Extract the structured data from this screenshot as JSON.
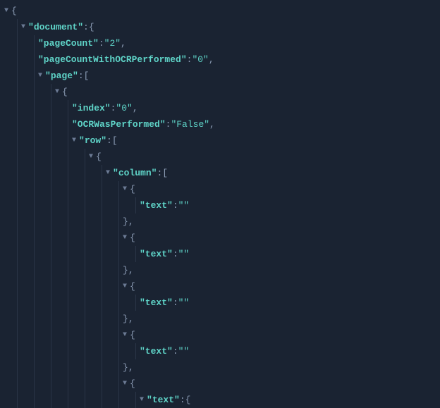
{
  "tree": {
    "rows": [
      {
        "indent": 0,
        "twisty": true,
        "parts": [
          {
            "t": "brace",
            "v": "{"
          }
        ]
      },
      {
        "indent": 1,
        "twisty": true,
        "parts": [
          {
            "t": "key",
            "v": "\"document\""
          },
          {
            "t": "punct",
            "v": ": "
          },
          {
            "t": "brace",
            "v": "{"
          }
        ]
      },
      {
        "indent": 2,
        "twisty": false,
        "parts": [
          {
            "t": "key",
            "v": "\"pageCount\""
          },
          {
            "t": "punct",
            "v": ": "
          },
          {
            "t": "value",
            "v": "\"2\""
          },
          {
            "t": "punct",
            "v": ","
          }
        ]
      },
      {
        "indent": 2,
        "twisty": false,
        "parts": [
          {
            "t": "key",
            "v": "\"pageCountWithOCRPerformed\""
          },
          {
            "t": "punct",
            "v": ": "
          },
          {
            "t": "value",
            "v": "\"0\""
          },
          {
            "t": "punct",
            "v": ","
          }
        ]
      },
      {
        "indent": 2,
        "twisty": true,
        "parts": [
          {
            "t": "key",
            "v": "\"page\""
          },
          {
            "t": "punct",
            "v": ": "
          },
          {
            "t": "brace",
            "v": "["
          }
        ]
      },
      {
        "indent": 3,
        "twisty": true,
        "parts": [
          {
            "t": "brace",
            "v": "{"
          }
        ]
      },
      {
        "indent": 4,
        "twisty": false,
        "parts": [
          {
            "t": "key",
            "v": "\"index\""
          },
          {
            "t": "punct",
            "v": ": "
          },
          {
            "t": "value",
            "v": "\"0\""
          },
          {
            "t": "punct",
            "v": ","
          }
        ]
      },
      {
        "indent": 4,
        "twisty": false,
        "parts": [
          {
            "t": "key",
            "v": "\"OCRWasPerformed\""
          },
          {
            "t": "punct",
            "v": ": "
          },
          {
            "t": "value",
            "v": "\"False\""
          },
          {
            "t": "punct",
            "v": ","
          }
        ]
      },
      {
        "indent": 4,
        "twisty": true,
        "parts": [
          {
            "t": "key",
            "v": "\"row\""
          },
          {
            "t": "punct",
            "v": ": "
          },
          {
            "t": "brace",
            "v": "["
          }
        ]
      },
      {
        "indent": 5,
        "twisty": true,
        "parts": [
          {
            "t": "brace",
            "v": "{"
          }
        ]
      },
      {
        "indent": 6,
        "twisty": true,
        "parts": [
          {
            "t": "key",
            "v": "\"column\""
          },
          {
            "t": "punct",
            "v": ": "
          },
          {
            "t": "brace",
            "v": "["
          }
        ]
      },
      {
        "indent": 7,
        "twisty": true,
        "parts": [
          {
            "t": "brace",
            "v": "{"
          }
        ]
      },
      {
        "indent": 8,
        "twisty": false,
        "parts": [
          {
            "t": "key",
            "v": "\"text\""
          },
          {
            "t": "punct",
            "v": ": "
          },
          {
            "t": "value",
            "v": "\"\""
          }
        ]
      },
      {
        "indent": 7,
        "twisty": false,
        "parts": [
          {
            "t": "brace",
            "v": "}"
          },
          {
            "t": "punct",
            "v": ","
          }
        ]
      },
      {
        "indent": 7,
        "twisty": true,
        "parts": [
          {
            "t": "brace",
            "v": "{"
          }
        ]
      },
      {
        "indent": 8,
        "twisty": false,
        "parts": [
          {
            "t": "key",
            "v": "\"text\""
          },
          {
            "t": "punct",
            "v": ": "
          },
          {
            "t": "value",
            "v": "\"\""
          }
        ]
      },
      {
        "indent": 7,
        "twisty": false,
        "parts": [
          {
            "t": "brace",
            "v": "}"
          },
          {
            "t": "punct",
            "v": ","
          }
        ]
      },
      {
        "indent": 7,
        "twisty": true,
        "parts": [
          {
            "t": "brace",
            "v": "{"
          }
        ]
      },
      {
        "indent": 8,
        "twisty": false,
        "parts": [
          {
            "t": "key",
            "v": "\"text\""
          },
          {
            "t": "punct",
            "v": ": "
          },
          {
            "t": "value",
            "v": "\"\""
          }
        ]
      },
      {
        "indent": 7,
        "twisty": false,
        "parts": [
          {
            "t": "brace",
            "v": "}"
          },
          {
            "t": "punct",
            "v": ","
          }
        ]
      },
      {
        "indent": 7,
        "twisty": true,
        "parts": [
          {
            "t": "brace",
            "v": "{"
          }
        ]
      },
      {
        "indent": 8,
        "twisty": false,
        "parts": [
          {
            "t": "key",
            "v": "\"text\""
          },
          {
            "t": "punct",
            "v": ": "
          },
          {
            "t": "value",
            "v": "\"\""
          }
        ]
      },
      {
        "indent": 7,
        "twisty": false,
        "parts": [
          {
            "t": "brace",
            "v": "}"
          },
          {
            "t": "punct",
            "v": ","
          }
        ]
      },
      {
        "indent": 7,
        "twisty": true,
        "parts": [
          {
            "t": "brace",
            "v": "{"
          }
        ]
      },
      {
        "indent": 8,
        "twisty": true,
        "parts": [
          {
            "t": "key",
            "v": "\"text\""
          },
          {
            "t": "punct",
            "v": ": "
          },
          {
            "t": "brace",
            "v": "{"
          }
        ]
      }
    ]
  },
  "twistyGlyph": "▼"
}
